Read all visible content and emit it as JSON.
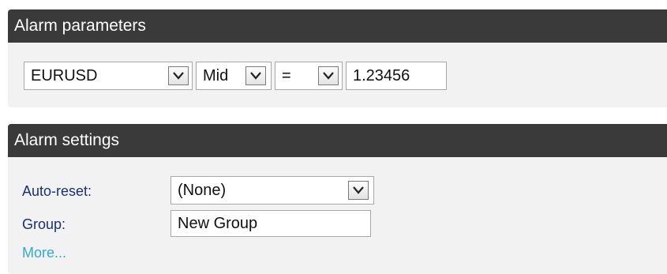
{
  "alarm_parameters": {
    "title": "Alarm parameters",
    "symbol": {
      "value": "EURUSD"
    },
    "price_type": {
      "value": "Mid"
    },
    "operator": {
      "value": "="
    },
    "price": {
      "value": "1.23456"
    }
  },
  "alarm_settings": {
    "title": "Alarm settings",
    "auto_reset": {
      "label": "Auto-reset:",
      "value": "(None)"
    },
    "group": {
      "label": "Group:",
      "value": "New Group"
    },
    "more_link": "More..."
  },
  "colors": {
    "header_bg": "#3a3a3a",
    "panel_bg": "#f2f2f2",
    "label_text": "#1c2f7a",
    "link_text": "#32a9d8"
  },
  "icons": [
    "chevron-down-icon"
  ]
}
